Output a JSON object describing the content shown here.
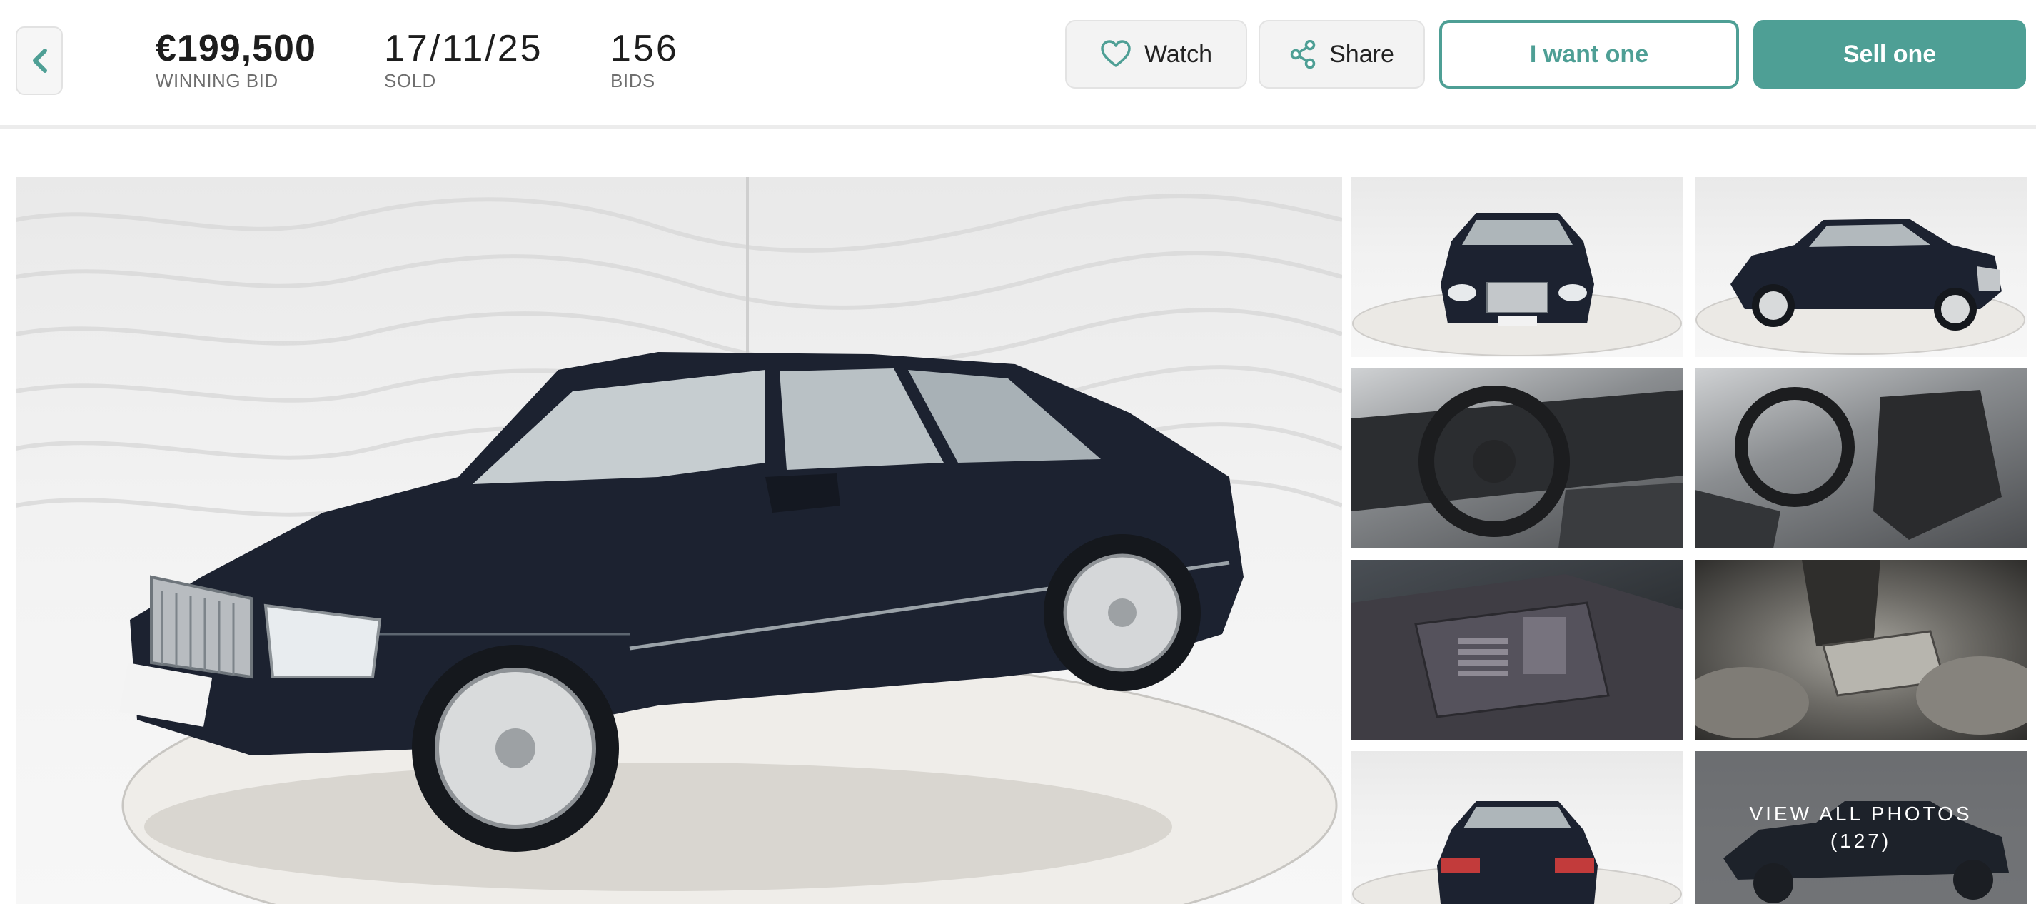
{
  "header": {
    "back_label": "",
    "winning_bid_value": "€199,500",
    "winning_bid_label": "WINNING BID",
    "sold_value": "17/11/25",
    "sold_label": "SOLD",
    "bids_value": "156",
    "bids_label": "BIDS",
    "watch_label": "Watch",
    "share_label": "Share",
    "want_label": "I want one",
    "sell_label": "Sell one"
  },
  "gallery": {
    "view_all_label": "VIEW ALL PHOTOS",
    "view_all_count": "(127)"
  },
  "colors": {
    "accent": "#4e9f95",
    "car_body": "#1c2230"
  }
}
